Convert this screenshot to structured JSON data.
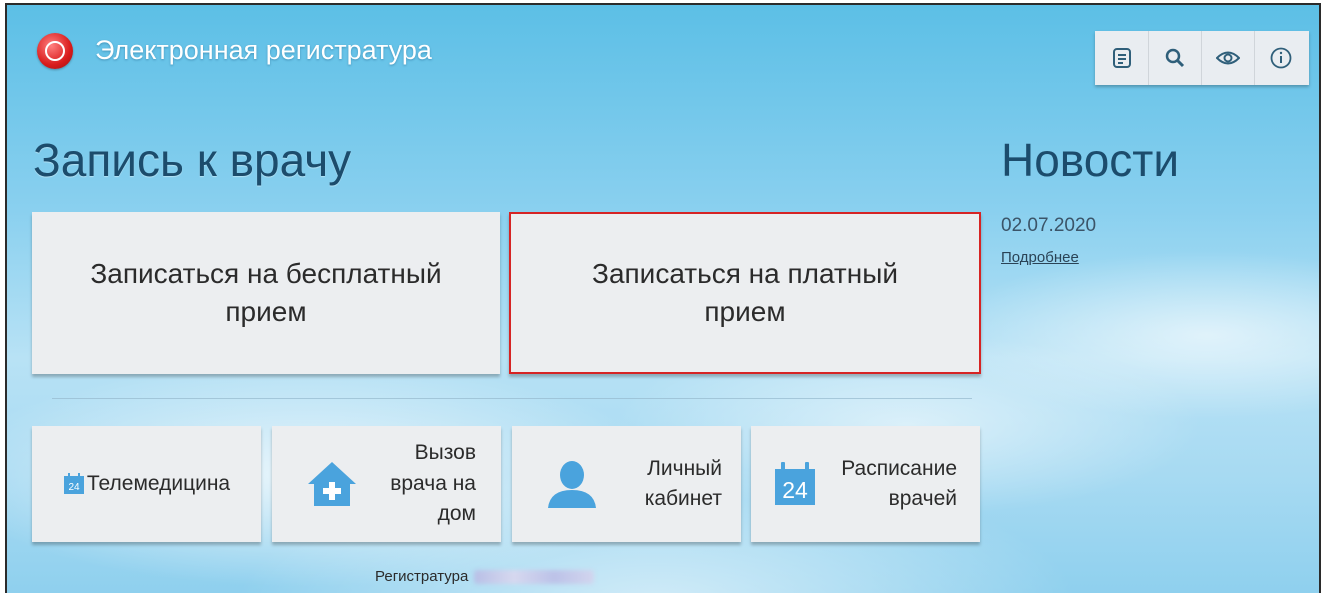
{
  "header": {
    "app_title": "Электронная регистратура"
  },
  "toolbar": {
    "items": [
      {
        "icon": "list-icon"
      },
      {
        "icon": "search-icon"
      },
      {
        "icon": "eye-icon"
      },
      {
        "icon": "info-icon"
      }
    ]
  },
  "main": {
    "heading": "Запись к врачу",
    "free_button": "Записаться на бесплатный прием",
    "paid_button": "Записаться на платный прием",
    "services": [
      {
        "label": "Телемедицина",
        "icon": "calendar-24-icon"
      },
      {
        "label": "Вызов врача на дом",
        "icon": "house-plus-icon"
      },
      {
        "label": "Личный кабинет",
        "icon": "user-icon"
      },
      {
        "label": "Расписание врачей",
        "icon": "calendar-24-icon",
        "icon_text": "24"
      }
    ],
    "footer_label": "Регистратура"
  },
  "news": {
    "heading": "Новости",
    "date": "02.07.2020",
    "link": "Подробнее"
  },
  "colors": {
    "highlight_border": "#d62424",
    "heading": "#1c4c6c"
  }
}
